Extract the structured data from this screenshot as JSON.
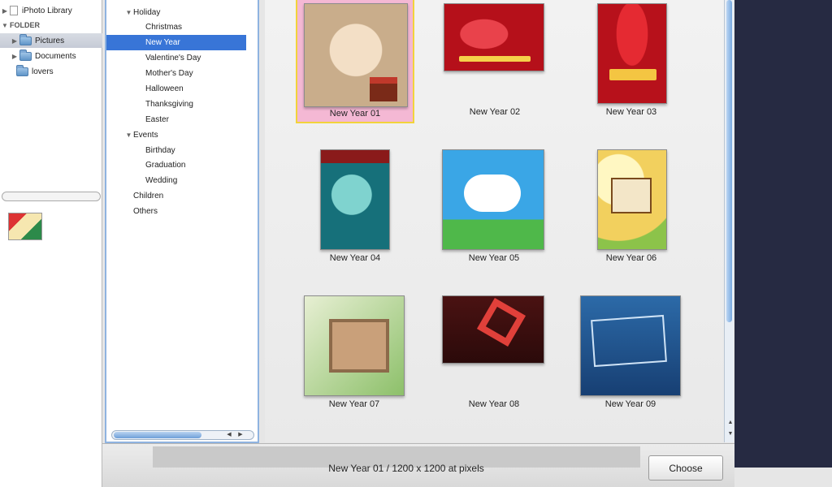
{
  "sidebar": {
    "library_item": "iPhoto Library",
    "folder_header": "FOLDER",
    "folders": [
      "Pictures",
      "Documents",
      "lovers"
    ]
  },
  "categories": {
    "items": [
      {
        "label": "Holiday",
        "level": 0,
        "expanded": true
      },
      {
        "label": "Christmas",
        "level": 1
      },
      {
        "label": "New Year",
        "level": 1,
        "selected": true
      },
      {
        "label": "Valentine's Day",
        "level": 1
      },
      {
        "label": "Mother's Day",
        "level": 1
      },
      {
        "label": "Halloween",
        "level": 1
      },
      {
        "label": "Thanksgiving",
        "level": 1
      },
      {
        "label": "Easter",
        "level": 1
      },
      {
        "label": "Events",
        "level": 0,
        "expanded": true
      },
      {
        "label": "Birthday",
        "level": 1
      },
      {
        "label": "Graduation",
        "level": 1
      },
      {
        "label": "Wedding",
        "level": 1
      },
      {
        "label": "Children",
        "level": 0
      },
      {
        "label": "Others",
        "level": 0
      }
    ]
  },
  "templates": [
    {
      "label": "New Year 01",
      "selected": true
    },
    {
      "label": "New Year 02"
    },
    {
      "label": "New Year 03"
    },
    {
      "label": "New Year 04"
    },
    {
      "label": "New Year 05"
    },
    {
      "label": "New Year 06"
    },
    {
      "label": "New Year 07"
    },
    {
      "label": "New Year 08"
    },
    {
      "label": "New Year 09"
    }
  ],
  "status": {
    "text": "New Year 01 / 1200 x 1200 at pixels"
  },
  "buttons": {
    "choose": "Choose"
  },
  "colors": {
    "selection": "#3875d7",
    "tile_selected_bg": "#f4b8d4",
    "tile_selected_border": "#f2d33b",
    "dark_panel": "#262a42"
  }
}
